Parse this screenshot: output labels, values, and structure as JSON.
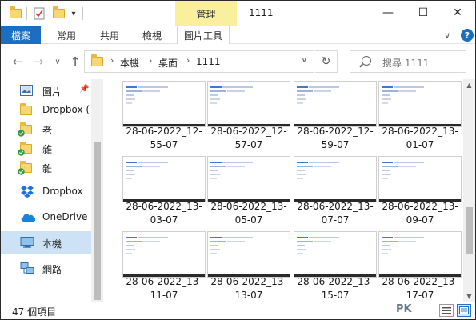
{
  "window": {
    "title": "1111",
    "context_tab": "管理",
    "controls": {
      "minimize": "—",
      "maximize": "☐",
      "close": "✕"
    }
  },
  "quick_access": {
    "dropdown": "▾"
  },
  "ribbon": {
    "file_tab": "檔案",
    "tabs": [
      "常用",
      "共用",
      "檢視",
      "圖片工具"
    ],
    "expand": "∨",
    "help": "?"
  },
  "navigation": {
    "back": "←",
    "forward": "→",
    "recent": "∨",
    "up": "↑",
    "breadcrumb": [
      "本機",
      "桌面",
      "1111"
    ],
    "crumb_sep": "›",
    "dropdown": "∨",
    "refresh": "↻",
    "search_placeholder": "搜尋 1111"
  },
  "sidebar": {
    "items": [
      {
        "label": "圖片",
        "icon": "pictures-icon",
        "pinned": true
      },
      {
        "label": "Dropbox (",
        "icon": "folder-icon"
      },
      {
        "label": "老",
        "icon": "folder-synced-icon"
      },
      {
        "label": "雜",
        "icon": "folder-synced-icon"
      },
      {
        "label": "雜",
        "icon": "folder-synced-icon"
      },
      {
        "label": "Dropbox",
        "icon": "dropbox-icon"
      },
      {
        "label": "OneDrive",
        "icon": "onedrive-icon"
      },
      {
        "label": "本機",
        "icon": "this-pc-icon",
        "selected": true
      },
      {
        "label": "網路",
        "icon": "network-icon"
      }
    ],
    "pin_glyph": "📌"
  },
  "files": [
    {
      "line1": "28-06-2022_12-",
      "line2": "55-07"
    },
    {
      "line1": "28-06-2022_12-",
      "line2": "57-07"
    },
    {
      "line1": "28-06-2022_12-",
      "line2": "59-07"
    },
    {
      "line1": "28-06-2022_13-",
      "line2": "01-07"
    },
    {
      "line1": "28-06-2022_13-",
      "line2": "03-07"
    },
    {
      "line1": "28-06-2022_13-",
      "line2": "05-07"
    },
    {
      "line1": "28-06-2022_13-",
      "line2": "07-07"
    },
    {
      "line1": "28-06-2022_13-",
      "line2": "09-07"
    },
    {
      "line1": "28-06-2022_13-",
      "line2": "11-07"
    },
    {
      "line1": "28-06-2022_13-",
      "line2": "13-07"
    },
    {
      "line1": "28-06-2022_13-",
      "line2": "15-07"
    },
    {
      "line1": "28-06-2022_13-",
      "line2": "17-07"
    }
  ],
  "status": {
    "item_count": "47 個項目",
    "watermark": "PK"
  },
  "colors": {
    "accent": "#1a6fc2",
    "context_tab": "#f9ef9c",
    "selected_nav": "#cde2f5"
  }
}
